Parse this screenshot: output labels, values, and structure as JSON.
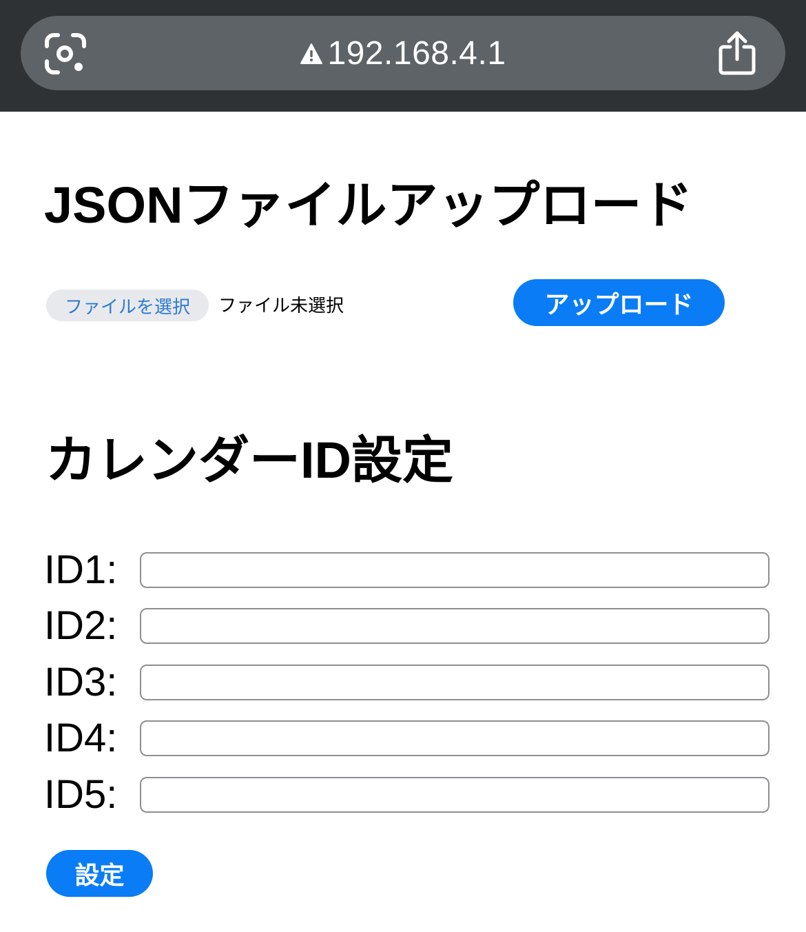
{
  "browser": {
    "url": "192.168.4.1",
    "left_icon": "lens-icon",
    "security_icon": "warning-icon",
    "right_icon": "share-icon"
  },
  "upload_section": {
    "title": "JSONファイルアップロード",
    "file_button_label": "ファイルを選択",
    "file_status": "ファイル未選択",
    "upload_button_label": "アップロード"
  },
  "calendar_section": {
    "title": "カレンダーID設定",
    "ids": [
      {
        "label": "ID1:",
        "value": ""
      },
      {
        "label": "ID2:",
        "value": ""
      },
      {
        "label": "ID3:",
        "value": ""
      },
      {
        "label": "ID4:",
        "value": ""
      },
      {
        "label": "ID5:",
        "value": ""
      }
    ],
    "submit_label": "設定"
  },
  "colors": {
    "top_bar": "#2f3235",
    "url_bar": "#5e6367",
    "primary_button": "#0a7cf6",
    "file_button_bg": "#e8e9ec",
    "file_button_text": "#2c7bd1"
  }
}
